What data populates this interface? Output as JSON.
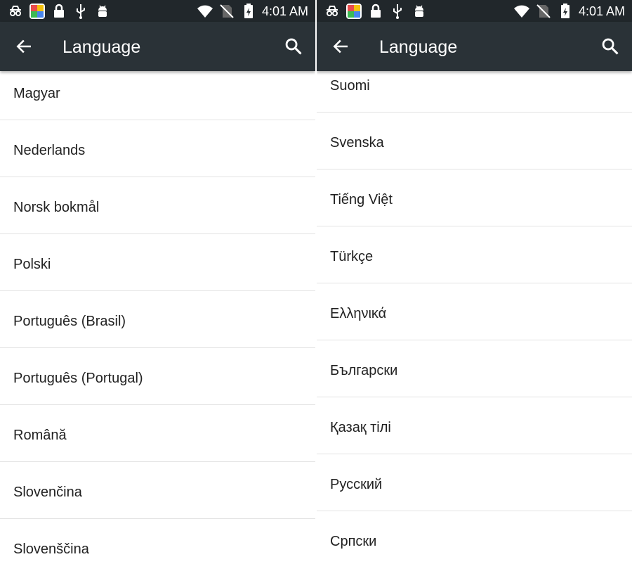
{
  "status_bar": {
    "time": "4:01 AM",
    "left_icons": [
      "incognito-icon",
      "app-icon",
      "lock-icon",
      "usb-icon",
      "android-debug-icon"
    ],
    "right_icons": [
      "wifi-icon",
      "no-sim-icon",
      "battery-charging-icon"
    ]
  },
  "app_bar": {
    "title": "Language",
    "back_icon": "arrow-back-icon",
    "search_icon": "search-icon"
  },
  "left_list": {
    "items": [
      {
        "label": "Magyar"
      },
      {
        "label": "Nederlands"
      },
      {
        "label": "Norsk bokmål"
      },
      {
        "label": "Polski"
      },
      {
        "label": "Português (Brasil)"
      },
      {
        "label": "Português (Portugal)"
      },
      {
        "label": "Română"
      },
      {
        "label": "Slovenčina"
      },
      {
        "label": "Slovenščina"
      }
    ]
  },
  "right_list": {
    "items": [
      {
        "label": "Suomi"
      },
      {
        "label": "Svenska"
      },
      {
        "label": "Tiếng Việt"
      },
      {
        "label": "Türkçe"
      },
      {
        "label": "Ελληνικά"
      },
      {
        "label": "Български"
      },
      {
        "label": "Қазақ тілі"
      },
      {
        "label": "Русский"
      },
      {
        "label": "Српски"
      }
    ]
  },
  "colors": {
    "status_bar": "#21272b",
    "app_bar": "#2a3237",
    "text": "#222222",
    "divider": "#e3e3e3"
  }
}
